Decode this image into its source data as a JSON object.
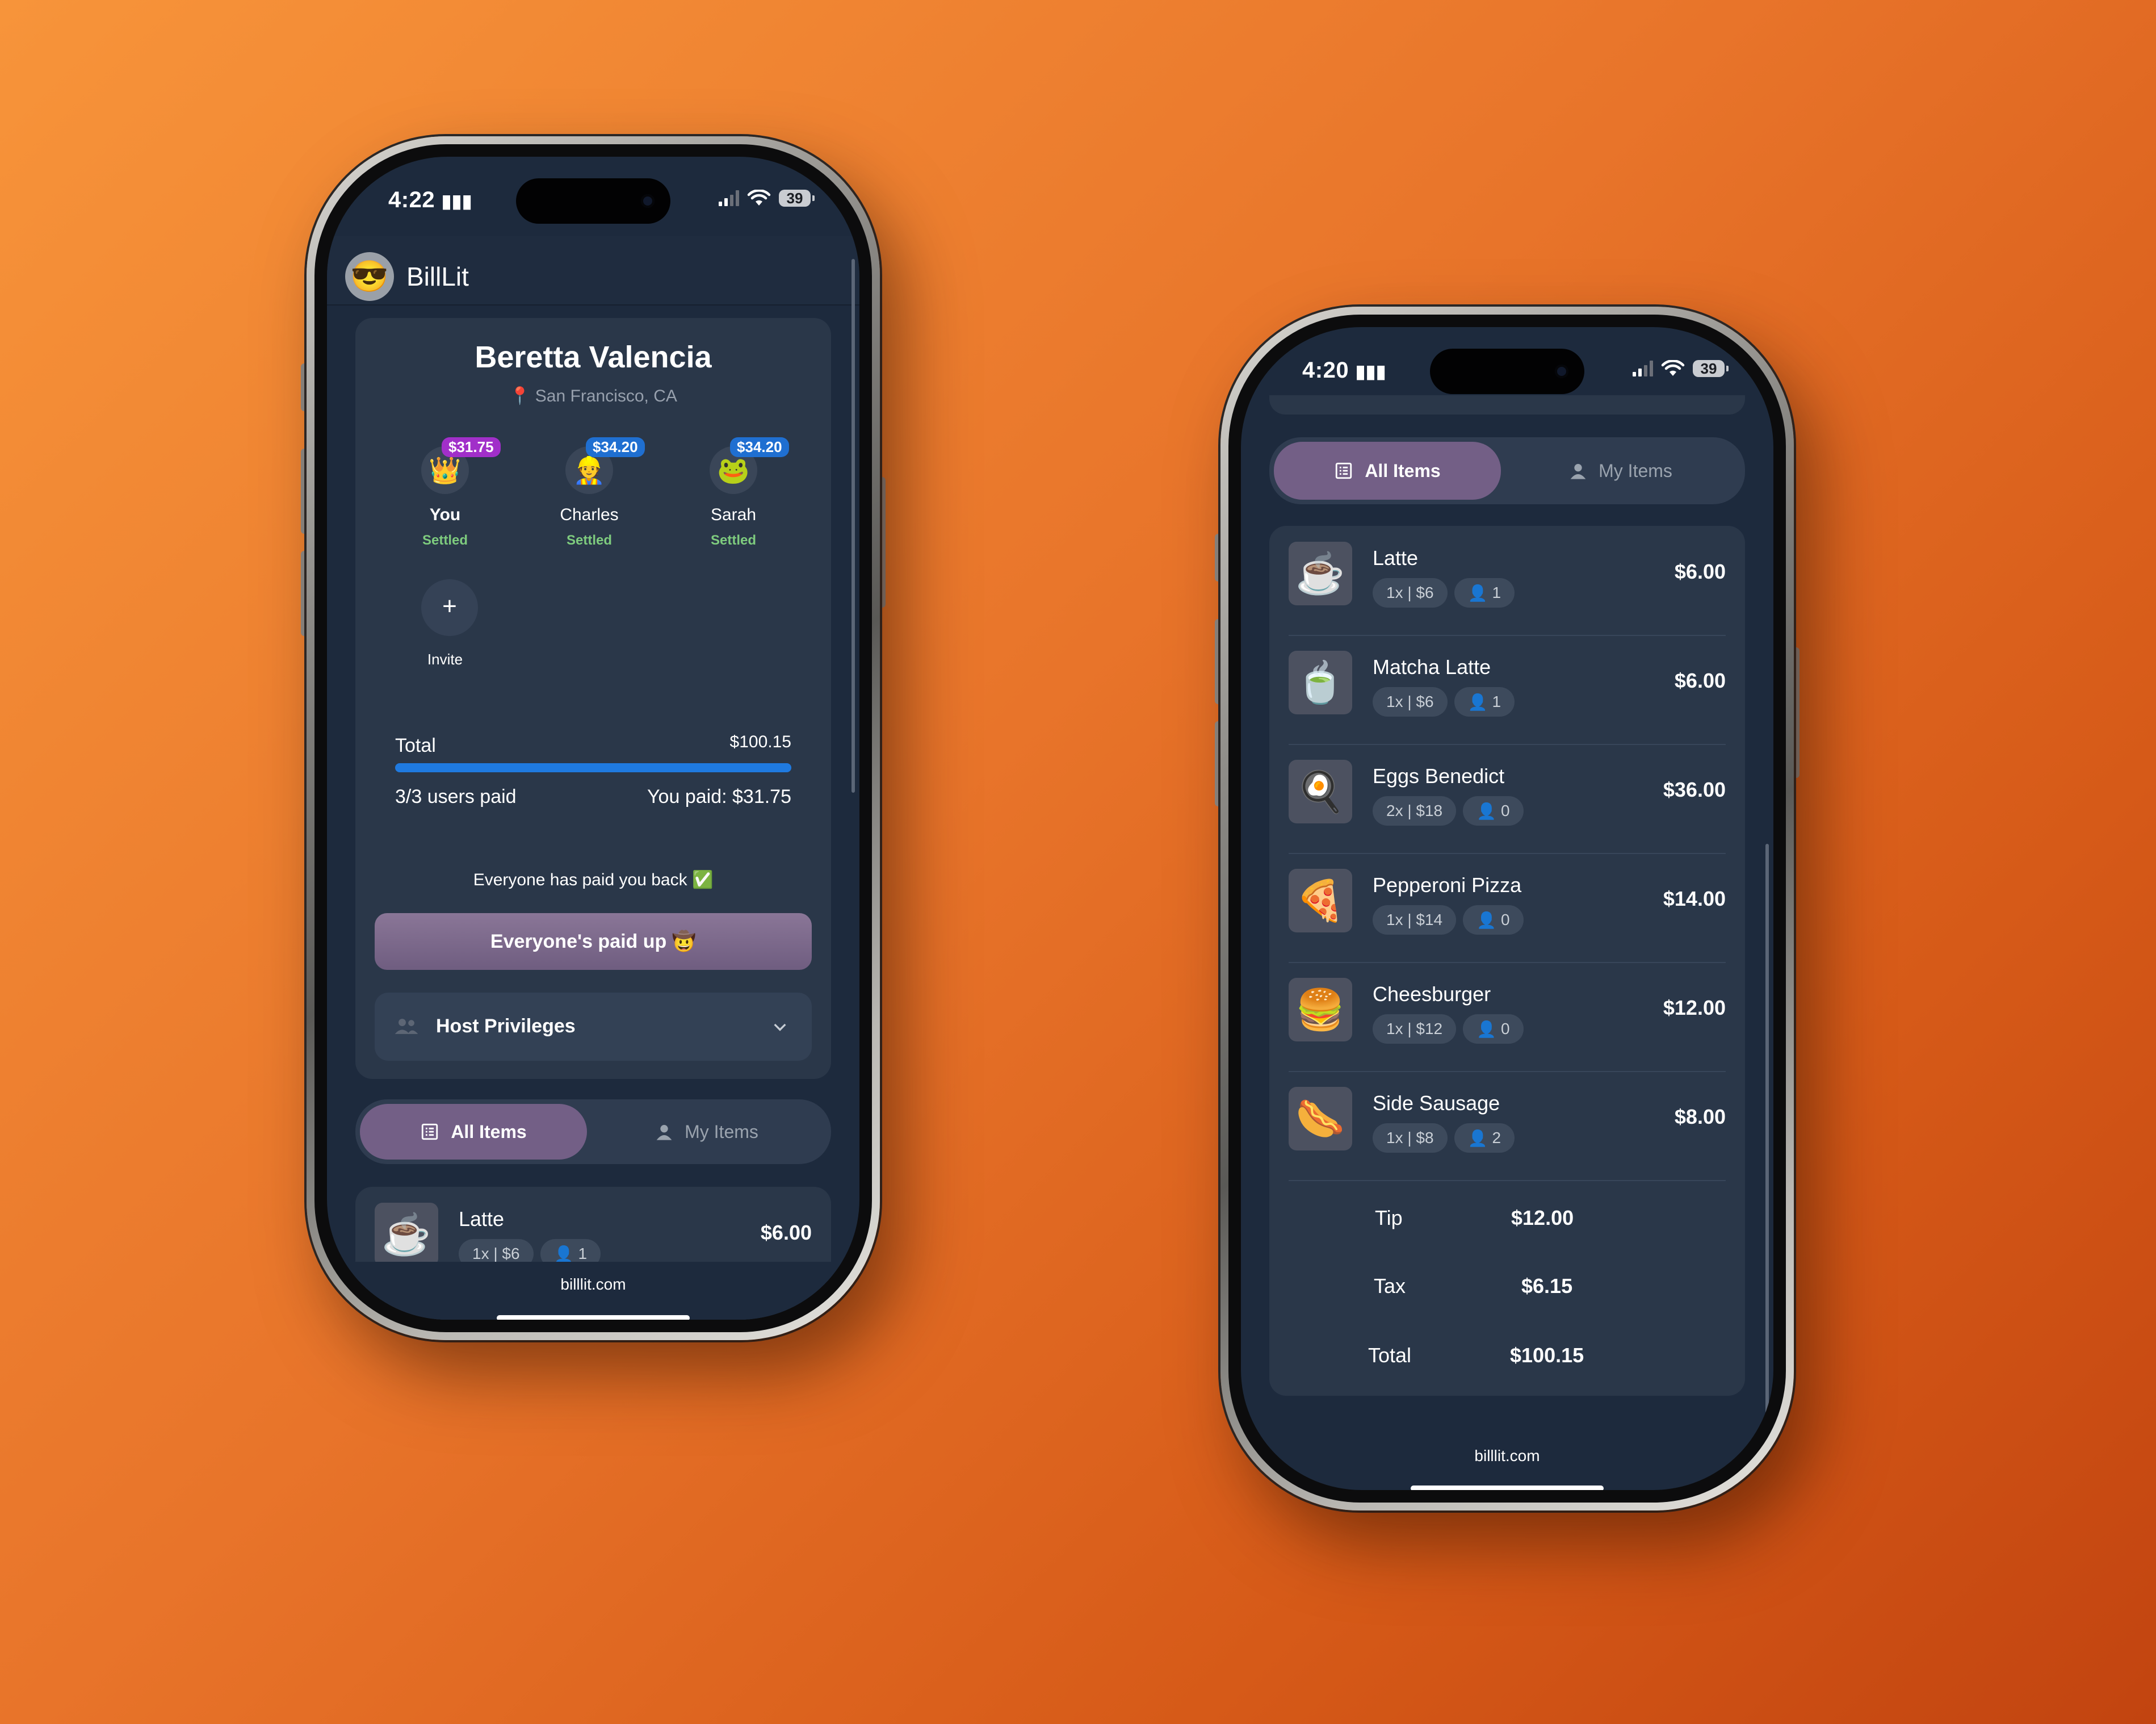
{
  "phone_left": {
    "status": {
      "time": "4:22",
      "battery": "39"
    },
    "app": {
      "logo_emoji": "😎",
      "name": "BillLit"
    },
    "bill": {
      "restaurant": "Beretta Valencia",
      "location": "San Francisco, CA",
      "location_icon": "📍"
    },
    "people": [
      {
        "name": "You",
        "status": "Settled",
        "amount": "$31.75",
        "emoji": "👑",
        "badge_color": "#a12fc9"
      },
      {
        "name": "Charles",
        "status": "Settled",
        "amount": "$34.20",
        "emoji": "👷",
        "badge_color": "#1f6fd1"
      },
      {
        "name": "Sarah",
        "status": "Settled",
        "amount": "$34.20",
        "emoji": "🐸",
        "badge_color": "#1f6fd1"
      }
    ],
    "invite": {
      "icon": "+",
      "label": "Invite"
    },
    "summary": {
      "total_label": "Total",
      "total_value": "$100.15",
      "users_paid": "3/3 users paid",
      "you_paid": "You paid: $31.75",
      "progress": 1.0
    },
    "paid_message": "Everyone has paid you back ✅",
    "paid_button": "Everyone's paid up 🤠",
    "host_privileges": "Host Privileges",
    "tabs": {
      "all": "All Items",
      "mine": "My Items"
    },
    "preview_item": {
      "name": "Latte",
      "emoji": "☕",
      "qty": "1x | $6",
      "people": "1",
      "price": "$6.00"
    },
    "footer": "billlit.com"
  },
  "phone_right": {
    "status": {
      "time": "4:20",
      "battery": "39"
    },
    "tabs": {
      "all": "All Items",
      "mine": "My Items"
    },
    "items": [
      {
        "name": "Latte",
        "emoji": "☕",
        "qty": "1x | $6",
        "people": "1",
        "price": "$6.00"
      },
      {
        "name": "Matcha Latte",
        "emoji": "🍵",
        "qty": "1x | $6",
        "people": "1",
        "price": "$6.00"
      },
      {
        "name": "Eggs Benedict",
        "emoji": "🍳",
        "qty": "2x | $18",
        "people": "0",
        "price": "$36.00"
      },
      {
        "name": "Pepperoni Pizza",
        "emoji": "🍕",
        "qty": "1x | $14",
        "people": "0",
        "price": "$14.00"
      },
      {
        "name": "Cheesburger",
        "emoji": "🍔",
        "qty": "1x | $12",
        "people": "0",
        "price": "$12.00"
      },
      {
        "name": "Side Sausage",
        "emoji": "🌭",
        "qty": "1x | $8",
        "people": "2",
        "price": "$8.00"
      }
    ],
    "totals": [
      {
        "label": "Tip",
        "value": "$12.00"
      },
      {
        "label": "Tax",
        "value": "$6.15"
      },
      {
        "label": "Total",
        "value": "$100.15"
      }
    ],
    "footer": "billlit.com"
  },
  "colors": {
    "background_orange": "#e8742a",
    "screen": "#1d2a3d",
    "accent_purple": "#735f86",
    "progress_blue": "#1f7ae0",
    "settled_green": "#7ecb7e"
  }
}
